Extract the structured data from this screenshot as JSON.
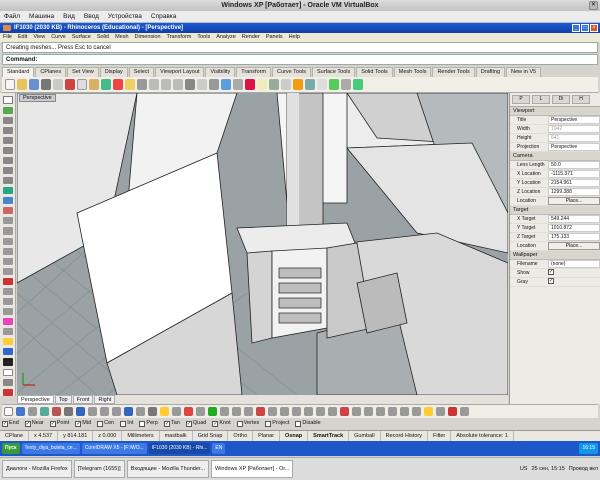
{
  "host": {
    "title": "Windows XP [Работает] - Oracle VM VirtualBox",
    "menu": [
      "Файл",
      "Машина",
      "Вид",
      "Ввод",
      "Устройства",
      "Справка"
    ]
  },
  "rhino": {
    "title": "IF1030 (2030 KB) - Rhinoceros (Educational) - [Perspective]",
    "menu": [
      "File",
      "Edit",
      "View",
      "Curve",
      "Surface",
      "Solid",
      "Mesh",
      "Dimension",
      "Transform",
      "Tools",
      "Analyze",
      "Render",
      "Panels",
      "Help"
    ],
    "history_line": "Creating meshes... Press Esc to cancel",
    "command_prompt": "Command:",
    "tabs": [
      "Standard",
      "CPlanes",
      "Set View",
      "Display",
      "Select",
      "Viewport Layout",
      "Visibility",
      "Transform",
      "Curve Tools",
      "Surface Tools",
      "Solid Tools",
      "Mesh Tools",
      "Render Tools",
      "Drafting",
      "New in V5"
    ],
    "active_tab": "Standard"
  },
  "viewport": {
    "label": "Perspective",
    "tabs": [
      "Perspective",
      "Top",
      "Front",
      "Right"
    ],
    "active_tab": "Perspective"
  },
  "panel": {
    "tabs": [
      "P",
      "L",
      "Di",
      "H"
    ],
    "viewport_section": "Viewport",
    "title_label": "Title",
    "title_value": "Perspective",
    "width_label": "Width",
    "width_value": "1042",
    "height_label": "Height",
    "height_value": "641",
    "projection_label": "Projection",
    "projection_value": "Perspective",
    "camera_section": "Camera",
    "lens_label": "Lens Length",
    "lens_value": "50.0",
    "xloc_label": "X Location",
    "xloc_value": "-1115.371",
    "yloc_label": "Y Location",
    "yloc_value": "2154.961",
    "zloc_label": "Z Location",
    "zloc_value": "1299.388",
    "location_label": "Location",
    "place_label": "Place...",
    "target_section": "Target",
    "xt_label": "X Target",
    "xt_value": "549.244",
    "yt_label": "Y Target",
    "yt_value": "1010.872",
    "zt_label": "Z Target",
    "zt_value": "175.133",
    "wallpaper_section": "Wallpaper",
    "filename_label": "Filename",
    "filename_value": "(none)",
    "show_label": "Show",
    "gray_label": "Gray",
    "show_checked": "✓",
    "gray_checked": "✓"
  },
  "osnaps": [
    "End",
    "Near",
    "Point",
    "Mid",
    "Cen",
    "Int",
    "Perp",
    "Tan",
    "Quad",
    "Knot",
    "Vertex",
    "Project",
    "Disable"
  ],
  "status": {
    "cplane": "CPlane",
    "x": "x 4.537",
    "y": "y 814.181",
    "z": "z 0.000",
    "units": "Millimeters",
    "layer": "mastbalk",
    "grid_snap": "Grid Snap",
    "ortho": "Ortho",
    "planar": "Planar",
    "osnap": "Osnap",
    "smarttrack": "SmartTrack",
    "gumball": "Gumball",
    "record_history": "Record History",
    "filter": "Filter",
    "tolerance": "Absolute tolerance: 1"
  },
  "xp_taskbar": {
    "start": "Пуск",
    "items": [
      "Texty_diya_buleta_ce...",
      "CorelDRAW X5 - [F:\\WO...",
      "IF1030 (2030 KB) - Rhi..."
    ],
    "active_item": "IF1030 (2030 KB) - Rhi...",
    "lang": "EN",
    "clock": "16:15"
  },
  "host_taskbar": {
    "items": [
      "Диалоги - Mozilla Firefox",
      "[Telegram (1655)]",
      "Входящие - Mozilla Thunder...",
      "Windows XP [Работает] - Or..."
    ],
    "active_item": "Windows XP [Работает] - Or...",
    "lang": "US",
    "date": "25 сен, 15:15",
    "user": "Провод вкл"
  }
}
